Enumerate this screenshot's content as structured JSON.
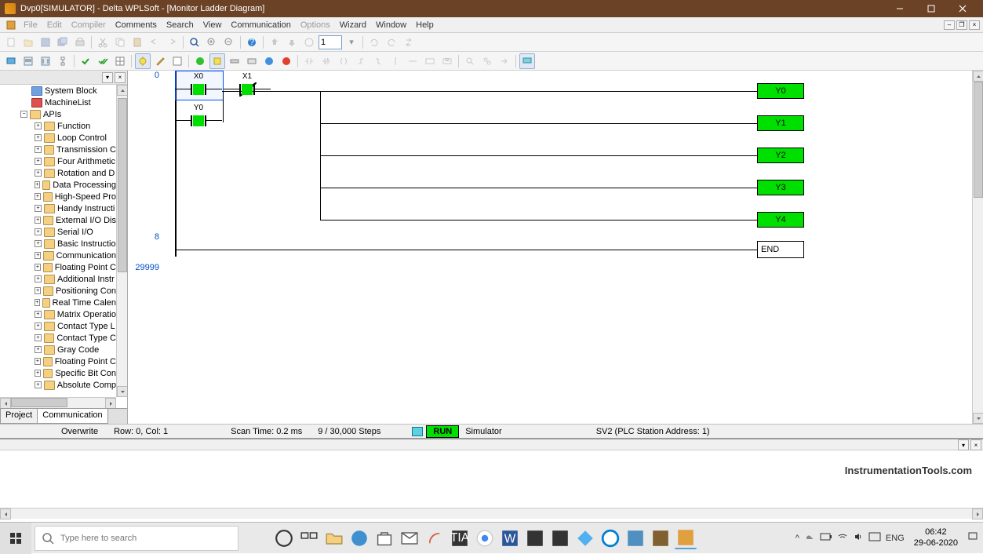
{
  "window": {
    "title": "Dvp0[SIMULATOR] - Delta WPLSoft - [Monitor Ladder Diagram]"
  },
  "menu": {
    "file": "File",
    "edit": "Edit",
    "compiler": "Compiler",
    "comments": "Comments",
    "search": "Search",
    "view": "View",
    "communication": "Communication",
    "options": "Options",
    "wizard": "Wizard",
    "window": "Window",
    "help": "Help"
  },
  "toolbar": {
    "step_value": "1"
  },
  "tree": {
    "sysblock": "System Block",
    "machinelist": "MachineList",
    "apis": "APIs",
    "items": [
      {
        "t": "+",
        "l": "Function"
      },
      {
        "t": "+",
        "l": "Loop Control"
      },
      {
        "t": "+",
        "l": "Transmission C"
      },
      {
        "t": "+",
        "l": "Four Arithmetic"
      },
      {
        "t": "+",
        "l": "Rotation and D"
      },
      {
        "t": "+",
        "l": "Data Processing"
      },
      {
        "t": "+",
        "l": "High-Speed Pro"
      },
      {
        "t": "+",
        "l": "Handy Instructi"
      },
      {
        "t": "+",
        "l": "External I/O Dis"
      },
      {
        "t": "+",
        "l": "Serial I/O"
      },
      {
        "t": "+",
        "l": "Basic Instructio"
      },
      {
        "t": "+",
        "l": "Communication"
      },
      {
        "t": "+",
        "l": "Floating Point C"
      },
      {
        "t": "+",
        "l": "Additional Instr"
      },
      {
        "t": "+",
        "l": "Positioning Con"
      },
      {
        "t": "+",
        "l": "Real Time Calen"
      },
      {
        "t": "+",
        "l": "Matrix Operatio"
      },
      {
        "t": "+",
        "l": "Contact Type L"
      },
      {
        "t": "+",
        "l": "Contact Type C"
      },
      {
        "t": "+",
        "l": "Gray Code"
      },
      {
        "t": "+",
        "l": "Floating Point C"
      },
      {
        "t": "+",
        "l": "Specific Bit Con"
      },
      {
        "t": "+",
        "l": "Absolute Comp"
      }
    ]
  },
  "sidebar_tabs": {
    "project": "Project",
    "communication": "Communication"
  },
  "ladder": {
    "contacts": {
      "x0": "X0",
      "y0": "Y0",
      "x1": "X1"
    },
    "coils": {
      "y0": "Y0",
      "y1": "Y1",
      "y2": "Y2",
      "y3": "Y3",
      "y4": "Y4"
    },
    "end": "END",
    "lines": {
      "l0": "0",
      "l8": "8",
      "l29999": "29999"
    }
  },
  "status": {
    "overwrite": "Overwrite",
    "rowcol": "Row: 0, Col: 1",
    "scantime": "Scan Time: 0.2 ms",
    "steps": "9 / 30,000 Steps",
    "run": "RUN",
    "simulator": "Simulator",
    "device": "SV2 (PLC Station Address: 1)"
  },
  "watermark": "InstrumentationTools.com",
  "taskbar": {
    "search_placeholder": "Type here to search",
    "lang": "ENG",
    "time": "06:42",
    "date": "29-06-2020"
  }
}
